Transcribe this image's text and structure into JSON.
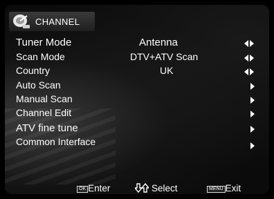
{
  "header": {
    "title": "CHANNEL",
    "icon": "satellite-dish-icon"
  },
  "menu": [
    {
      "label": "Tuner Mode",
      "value": "Antenna",
      "control": "left-right"
    },
    {
      "label": "Scan Mode",
      "value": "DTV+ATV Scan",
      "control": "left-right"
    },
    {
      "label": "Country",
      "value": "UK",
      "control": "left-right"
    },
    {
      "label": "Auto Scan",
      "value": "",
      "control": "right"
    },
    {
      "label": "Manual Scan",
      "value": "",
      "control": "right"
    },
    {
      "label": "Channel Edit",
      "value": "",
      "control": "right"
    },
    {
      "label": "ATV fine tune",
      "value": "",
      "control": "right"
    },
    {
      "label": "Common Interface",
      "value": "",
      "control": "right"
    }
  ],
  "footer": {
    "ok_key": "OK",
    "enter_label": "Enter",
    "select_label": "Select",
    "menu_key": "MENU",
    "exit_label": "Exit"
  }
}
